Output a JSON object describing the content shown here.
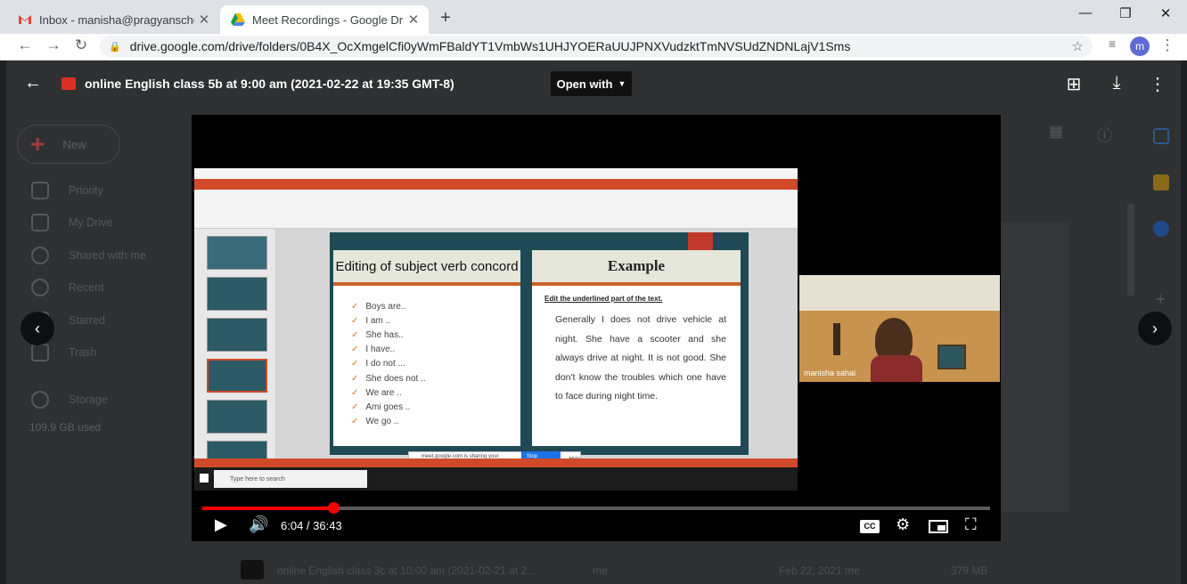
{
  "browser": {
    "tabs": [
      {
        "title": "Inbox - manisha@pragyanschool",
        "favicon": "gmail-icon",
        "active": false
      },
      {
        "title": "Meet Recordings - Google Drive",
        "favicon": "drive-icon",
        "active": true
      }
    ],
    "url": "drive.google.com/drive/folders/0B4X_OcXmgelCfi0yWmFBaldYT1VmbWs1UHJYOERaUUJPNXVudzktTmNVSUdZNDNLajV1Sms",
    "profile_initial": "m"
  },
  "drive_bg": {
    "new_label": "New",
    "sidebar": [
      {
        "label": "Priority",
        "icon": "checkbox-icon"
      },
      {
        "label": "My Drive",
        "icon": "drive-folder-icon"
      },
      {
        "label": "Shared with me",
        "icon": "people-icon"
      },
      {
        "label": "Recent",
        "icon": "clock-icon"
      },
      {
        "label": "Starred",
        "icon": "star-icon"
      },
      {
        "label": "Trash",
        "icon": "trash-icon"
      }
    ],
    "storage_label": "Storage",
    "storage_used": "109.9 GB used",
    "row": {
      "name": "online English class 3c at 10:00 am (2021-02-21 at 2...",
      "owner": "me",
      "modified": "Feb 22, 2021 me",
      "size": "379 MB"
    }
  },
  "preview": {
    "title": "online English class 5b at 9:00 am (2021-02-22 at 19:35 GMT-8)",
    "open_with": "Open with"
  },
  "player": {
    "time_current": "6:04",
    "time_total": "36:43",
    "time_display": "6:04 / 36:43",
    "progress_fraction": 0.1667,
    "cc_label": "CC"
  },
  "slide": {
    "left_heading": "Editing of subject verb concord",
    "bullets": [
      "Boys are..",
      "I am ..",
      "She has..",
      "I have..",
      "I do not ...",
      "She does not ..",
      "We are ..",
      "Ami goes ..",
      "We go .."
    ],
    "right_heading": "Example",
    "right_sub": "Edit the underlined part of the text.",
    "right_text": "Generally I does not drive vehicle at night. She have a scooter and she always drive at night. It is not good. She don't know the troubles which one have to face during night time.",
    "taskbar_search": "Type here to search",
    "sharing_text": "meet.google.com is sharing your screen.",
    "stop_sharing": "Stop sharing",
    "hide": "Hide"
  },
  "camera": {
    "participant_name": "manisha sahai"
  },
  "colors": {
    "accent_red": "#ff0000",
    "pptx_orange": "#d04a2a",
    "slide_teal": "#1f4a55"
  }
}
